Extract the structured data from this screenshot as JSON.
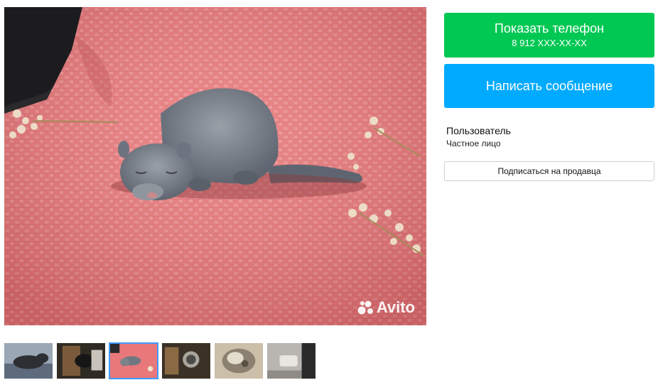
{
  "photo": {
    "watermark": "Avito"
  },
  "thumbnails": {
    "count": 6,
    "active_index": 2
  },
  "contact": {
    "show_phone_label": "Показать телефон",
    "phone_masked": "8 912 XXX-XX-XX",
    "message_label": "Написать сообщение"
  },
  "seller": {
    "name": "Пользователь",
    "type": "Частное лицо",
    "subscribe_label": "Подписаться на продавца"
  },
  "colors": {
    "phone_button": "#00c853",
    "message_button": "#00aaff",
    "active_thumb_border": "#3f9bff"
  }
}
